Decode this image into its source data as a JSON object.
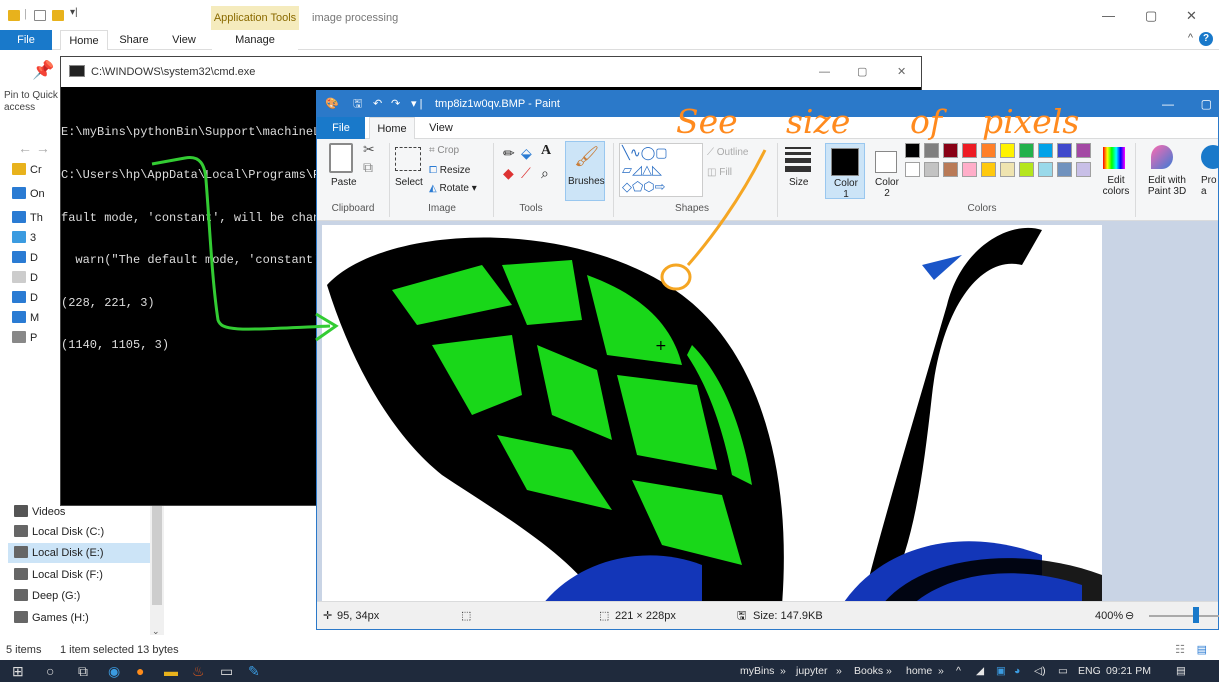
{
  "explorer": {
    "ribbon_tabs": {
      "file": "File",
      "home": "Home",
      "share": "Share",
      "view": "View",
      "manage": "Manage"
    },
    "context_tab": "Application Tools",
    "title": "image processing",
    "pin_label": "Pin to Quick access",
    "nav_items": [
      "Cr",
      "On",
      "Th",
      "3",
      "D",
      "D",
      "D",
      "M",
      "P"
    ],
    "nav_named": [
      {
        "label": "Videos"
      },
      {
        "label": "Local Disk (C:)"
      },
      {
        "label": "Local Disk (E:)"
      },
      {
        "label": "Local Disk (F:)"
      },
      {
        "label": "Deep (G:)"
      },
      {
        "label": "Games (H:)"
      }
    ],
    "status": {
      "items": "5 items",
      "selected": "1 item selected 13 bytes"
    }
  },
  "cmd": {
    "title": "C:\\WINDOWS\\system32\\cmd.exe",
    "lines": [
      "E:\\myBins\\pythonBin\\Support\\machineLe",
      "C:\\Users\\hp\\AppData\\Local\\Programs\\P",
      "fault mode, 'constant', will be chan",
      "  warn(\"The default mode, 'constant'",
      "(228, 221, 3)",
      "(1140, 1105, 3)"
    ]
  },
  "paint": {
    "title": "tmp8iz1w0qv.BMP - Paint",
    "tabs": {
      "file": "File",
      "home": "Home",
      "view": "View"
    },
    "groups": {
      "clipboard": "Clipboard",
      "image": "Image",
      "tools": "Tools",
      "shapes": "Shapes",
      "colors": "Colors"
    },
    "buttons": {
      "paste": "Paste",
      "select": "Select",
      "crop": "Crop",
      "resize": "Resize",
      "rotate": "Rotate",
      "brushes": "Brushes",
      "outline": "Outline",
      "fill": "Fill",
      "size": "Size",
      "color1": "Color 1",
      "color2": "Color 2",
      "edit_colors": "Edit colors",
      "edit_paint3d": "Edit with Paint 3D",
      "product_alert": "Pro a"
    },
    "palette_row1": [
      "#000000",
      "#7f7f7f",
      "#880015",
      "#ed1c24",
      "#ff7f27",
      "#fff200",
      "#22b14c",
      "#00a2e8",
      "#3f48cc",
      "#a349a4"
    ],
    "palette_row2": [
      "#ffffff",
      "#c3c3c3",
      "#b97a57",
      "#ffaec9",
      "#ffc90e",
      "#efe4b0",
      "#b5e61d",
      "#99d9ea",
      "#7092be",
      "#c8bfe7"
    ],
    "status": {
      "cursor_pos": "95, 34px",
      "dimensions": "221 × 228px",
      "size": "Size: 147.9KB",
      "zoom": "400%"
    }
  },
  "annotation": {
    "words": [
      "See",
      "size",
      "of",
      "pixels"
    ],
    "color": "#ff8a1e",
    "arrow_color": "#33cc33"
  },
  "taskbar": {
    "tray_items": [
      "myBins",
      "jupyter",
      "Books",
      "home"
    ],
    "lang": "ENG",
    "time": "09:21 PM"
  }
}
